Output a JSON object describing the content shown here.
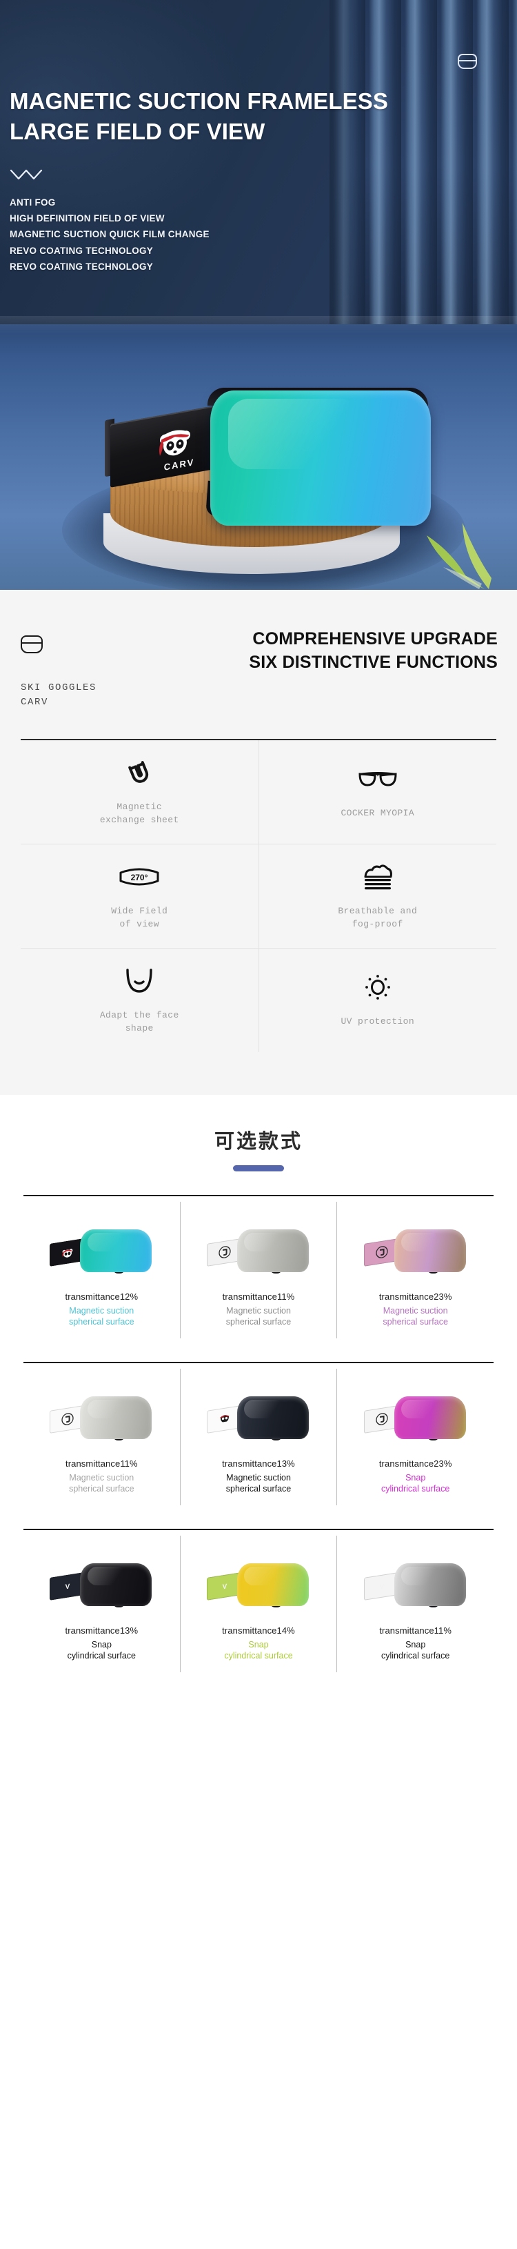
{
  "hero": {
    "title_lines": [
      "MAGNETIC SUCTION FRAMELESS",
      "LARGE FIELD OF VIEW"
    ],
    "bullets": [
      "ANTI FOG",
      "HIGH DEFINITION FIELD OF VIEW",
      "MAGNETIC SUCTION QUICK FILM CHANGE",
      "REVO COATING TECHNOLOGY",
      "REVO COATING TECHNOLOGY"
    ],
    "brand_on_strap": "CARV",
    "icons": {
      "case": "goggle-case-icon",
      "wave": "wave-divider-icon",
      "logo": "panda-ninja-logo"
    },
    "colors": {
      "bg_dark": "#1c2c44",
      "ice": "#4a6fa5",
      "lens": "#2bc8d6"
    }
  },
  "features": {
    "brand": {
      "line1": "SKI GOGGLES",
      "line2": "CARV",
      "icon": "goggle-case-icon"
    },
    "title_lines": [
      "COMPREHENSIVE UPGRADE",
      "SIX DISTINCTIVE FUNCTIONS"
    ],
    "items": [
      {
        "icon": "magnet-icon",
        "label": "Magnetic\nexchange sheet"
      },
      {
        "icon": "eyeglasses-icon",
        "label": "COCKER MYOPIA"
      },
      {
        "icon": "wide-view-icon",
        "label": "Wide Field\nof view",
        "badge": "270°"
      },
      {
        "icon": "breathable-icon",
        "label": "Breathable and\nfog-proof"
      },
      {
        "icon": "face-shape-icon",
        "label": "Adapt the face\nshape"
      },
      {
        "icon": "sun-icon",
        "label": "UV protection"
      }
    ]
  },
  "styles": {
    "title": "可选款式",
    "accent_color": "#5566ac",
    "rows": [
      {
        "items": [
          {
            "transmittance": "transmittance12%",
            "desc": "Magnetic suction\nspherical surface",
            "desc_color": "#4fc3d4",
            "lens_color": "linear-gradient(100deg,#18c3a8,#2ec9cf,#35b4ea)",
            "strap_color": "#141418",
            "logo": "panda-ninja-logo"
          },
          {
            "transmittance": "transmittance11%",
            "desc": "Magnetic suction\nspherical surface",
            "desc_color": "#8f8f8f",
            "lens_color": "linear-gradient(100deg,#d9d9d6,#b9b9b4,#9e9e99)",
            "strap_color": "#f2f2f2",
            "logo": "carv-roundel-logo"
          },
          {
            "transmittance": "transmittance23%",
            "desc": "Magnetic suction\nspherical surface",
            "desc_color": "#b673c0",
            "lens_color": "linear-gradient(100deg,#e3b79e,#c79ac8,#9a7f60)",
            "strap_color": "#d79cbe",
            "logo": "carv-roundel-logo"
          }
        ]
      },
      {
        "items": [
          {
            "transmittance": "transmittance11%",
            "desc": "Magnetic suction\nspherical surface",
            "desc_color": "#a5a5a5",
            "lens_color": "linear-gradient(100deg,#e2e2de,#c2c2bd,#a6a6a1)",
            "strap_color": "#fafafa",
            "logo": "carv-roundel-logo"
          },
          {
            "transmittance": "transmittance13%",
            "desc": "Magnetic suction\nspherical surface",
            "desc_color": "#161616",
            "lens_color": "linear-gradient(100deg,#2e3440,#1b2029,#12161d)",
            "strap_color": "#fbfbfb",
            "logo": "skull-logo"
          },
          {
            "transmittance": "transmittance23%",
            "desc": "Snap\ncylindrical surface",
            "desc_color": "#d62fd6",
            "lens_color": "linear-gradient(100deg,#d83fb8,#c43fbf,#a89a3f)",
            "strap_color": "#f5f5f5",
            "logo": "carv-roundel-logo"
          }
        ]
      },
      {
        "items": [
          {
            "transmittance": "transmittance13%",
            "desc": "Snap\ncylindrical surface",
            "desc_color": "#161616",
            "lens_color": "linear-gradient(100deg,#2a2a2e,#18181c,#0e0e12)",
            "strap_color": "#20242e",
            "logo": "carv-text-logo"
          },
          {
            "transmittance": "transmittance14%",
            "desc": "Snap\ncylindrical surface",
            "desc_color": "#aacb3a",
            "lens_color": "linear-gradient(100deg,#f0c81d,#e8cb2a,#7fd46a)",
            "strap_color": "#b7d65a",
            "logo": "carv-text-logo"
          },
          {
            "transmittance": "transmittance11%",
            "desc": "Snap\ncylindrical surface",
            "desc_color": "#161616",
            "lens_color": "linear-gradient(100deg,#dedede,#9a9a9a,#6f6f6f)",
            "strap_color": "#f4f4f4",
            "logo": "carv-text-logo"
          }
        ]
      }
    ]
  }
}
